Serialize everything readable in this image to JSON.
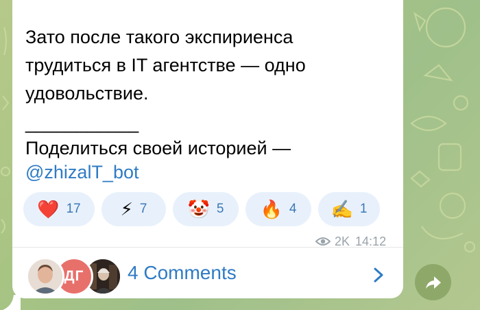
{
  "message": {
    "text": "Зато после такого экспириенса\nтрудиться в IT агентстве — одно\nудовольствие.",
    "divider": "___________",
    "share_prompt": "Поделиться своей историей —",
    "bot_link": "@zhizalT_bot"
  },
  "reactions": [
    {
      "emoji": "❤️",
      "count": "17",
      "icon": "heart-icon"
    },
    {
      "emoji": "⚡",
      "count": "7",
      "icon": "lightning-icon"
    },
    {
      "emoji": "🤡",
      "count": "5",
      "icon": "clown-icon"
    },
    {
      "emoji": "🔥",
      "count": "4",
      "icon": "fire-icon"
    },
    {
      "emoji": "✍️",
      "count": "1",
      "icon": "writing-hand-icon"
    }
  ],
  "meta": {
    "views": "2K",
    "time": "14:12"
  },
  "comments": {
    "label": "4 Comments",
    "avatar_initials": "ДГ"
  },
  "colors": {
    "link": "#2e7bc4",
    "reaction_bg": "#e8f1fb",
    "share_button": "#8ea86a"
  }
}
